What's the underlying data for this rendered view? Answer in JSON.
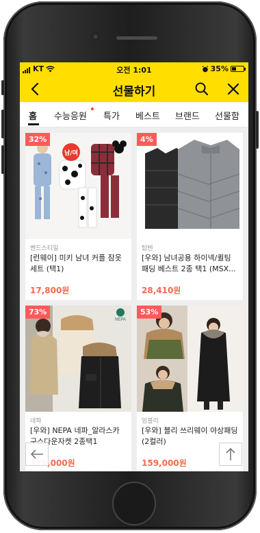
{
  "status": {
    "carrier": "KT",
    "time": "오전 1:01",
    "battery": "35%",
    "battery_level": 0.35
  },
  "header": {
    "title": "선물하기",
    "back_icon": "back-arrow-icon",
    "search_icon": "search-icon",
    "close_icon": "close-icon"
  },
  "tabs": [
    {
      "label": "홈",
      "active": true
    },
    {
      "label": "수능응원",
      "has_dot": true
    },
    {
      "label": "특가"
    },
    {
      "label": "베스트"
    },
    {
      "label": "브랜드"
    },
    {
      "label": "선물함"
    }
  ],
  "products": [
    {
      "discount": "32%",
      "tag": "남/여",
      "brand": "벤드스티일",
      "name": "[런웨이] 미키 남녀 커플 잠옷 세트 (택1)",
      "price": "17,800원"
    },
    {
      "discount": "4%",
      "brand": "탑텐",
      "name": "[우와] 남녀공용 하이넥/퀼팅 패딩 베스트 2종 택1 (MSX...",
      "price": "28,410원"
    },
    {
      "discount": "73%",
      "brand": "네파",
      "name": "[우와] NEPA 네파_알라스카 구스다운자켓 2종택1",
      "price": "129,000원"
    },
    {
      "discount": "53%",
      "brand": "임블리",
      "name": "[우와] 블리 쓰리웨이 야상패딩 (2컬러)",
      "price": "159,000원"
    }
  ],
  "controls": {
    "back_float_icon": "left-arrow-icon",
    "top_float_icon": "up-arrow-icon"
  },
  "colors": {
    "accent": "#ffde00",
    "price": "#f26b4f",
    "badge": "#ff5a5a"
  }
}
